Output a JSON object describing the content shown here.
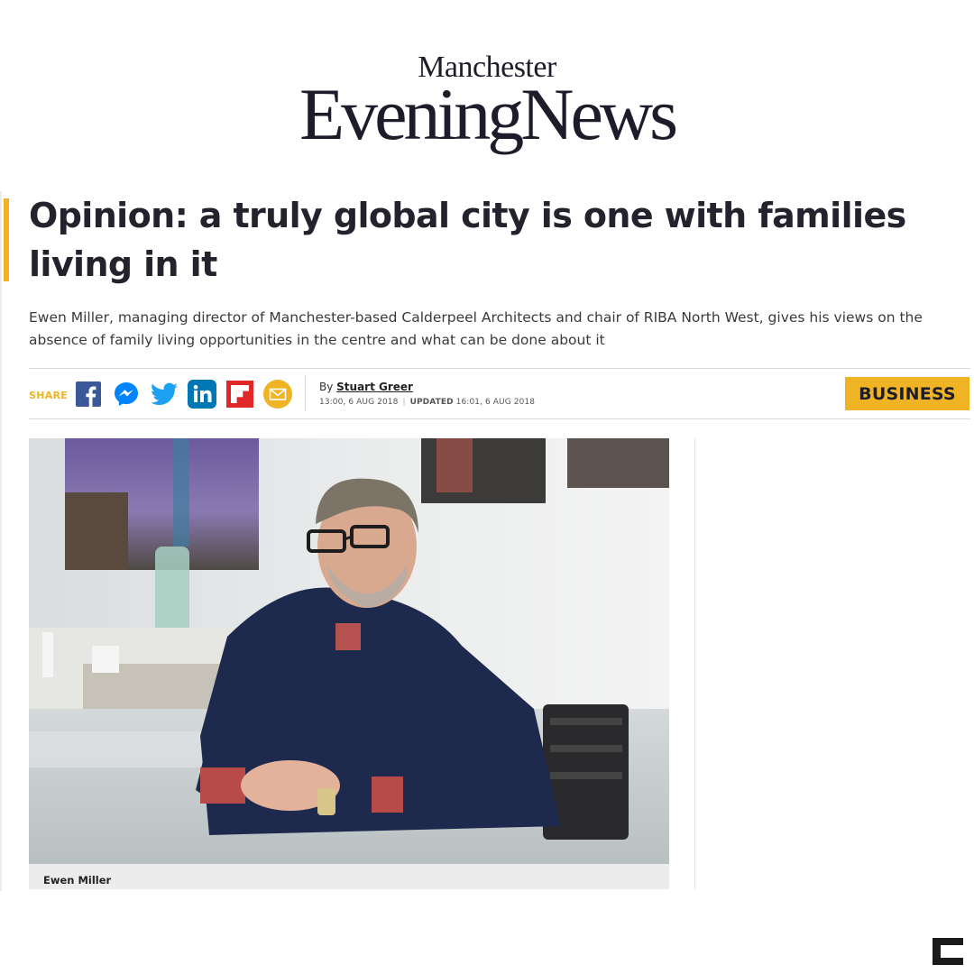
{
  "masthead": {
    "top": "Manchester",
    "main": "EveningNews"
  },
  "article": {
    "headline": "Opinion: a truly global city is one with families living in it",
    "standfirst": "Ewen Miller, managing director of Manchester-based Calderpeel Architects and chair of RIBA North West, gives his views on the absence of family living opportunities in the centre and what can be done about it",
    "byline_prefix": "By ",
    "author": "Stuart Greer",
    "published": "13:00, 6 AUG 2018",
    "updated_label": "UPDATED",
    "updated": "16:01, 6 AUG 2018",
    "section": "BUSINESS"
  },
  "share": {
    "label": "SHARE",
    "icons": [
      "facebook-icon",
      "messenger-icon",
      "twitter-icon",
      "linkedin-icon",
      "flipboard-icon",
      "email-icon"
    ]
  },
  "image": {
    "caption": "Ewen Miller"
  },
  "colors": {
    "accent": "#f0b323",
    "facebook": "#3b5998",
    "messenger": "#0084ff",
    "twitter": "#1da1f2",
    "linkedin": "#0077b5",
    "flipboard": "#e12828",
    "email": "#f0b323"
  }
}
